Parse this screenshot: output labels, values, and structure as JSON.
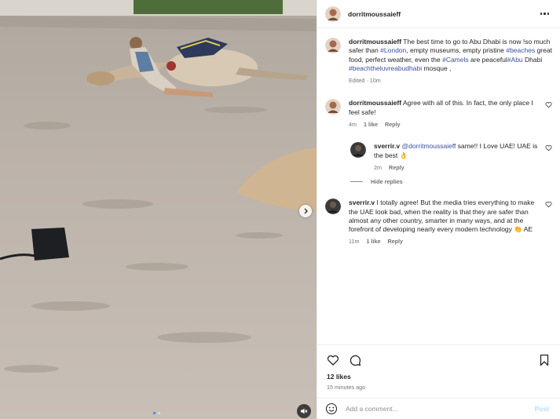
{
  "post": {
    "author": "dorritmoussaieff",
    "caption": {
      "parts": [
        "The best time to go to Abu Dhabi is now !so much safer than ",
        "#London",
        ", empty museums, empty pristine ",
        "#beaches",
        " great food, perfect weather, even the ",
        "#Camels",
        " are peaceful",
        "#Abu",
        " Dhabi ",
        "#beachtheluvreabudhabi",
        " mosque ,"
      ],
      "meta": "Edited · 10m"
    },
    "likes": "12 likes",
    "time_ago": "15 minutes ago"
  },
  "comments": [
    {
      "user": "dorritmoussaieff",
      "text": "Agree with all of this. In fact, the only place I feel safe!",
      "time": "4m",
      "likes": "1 like",
      "reply": "Reply"
    },
    {
      "user": "sverrir.v",
      "mention": "@dorritmoussaieff",
      "text": " same!! I Love UAE! UAE is the best 👌",
      "time": "2m",
      "reply": "Reply"
    },
    {
      "user": "sverrir.v",
      "text": "I totally agree! But the media tries everything to make the UAE look bad, when the reality is that they are safer than almost any other country, smarter in many ways, and at the forefront of developing nearly every modern technology 👏 AE",
      "time": "11m",
      "likes": "1 like",
      "reply": "Reply"
    }
  ],
  "hide_replies": "Hide replies",
  "add_comment": {
    "placeholder": "Add a comment...",
    "post_label": "Post"
  },
  "icons": {
    "like": "heart-icon",
    "comment": "comment-icon",
    "save": "bookmark-icon",
    "emoji": "smiley-icon",
    "more": "more-options-icon",
    "next": "chevron-right-icon",
    "mute": "speaker-muted-icon"
  },
  "colors": {
    "link": "#3b4fa0",
    "post_disabled": "#b2dffc",
    "media_accent_dot": "#3b82f6"
  }
}
